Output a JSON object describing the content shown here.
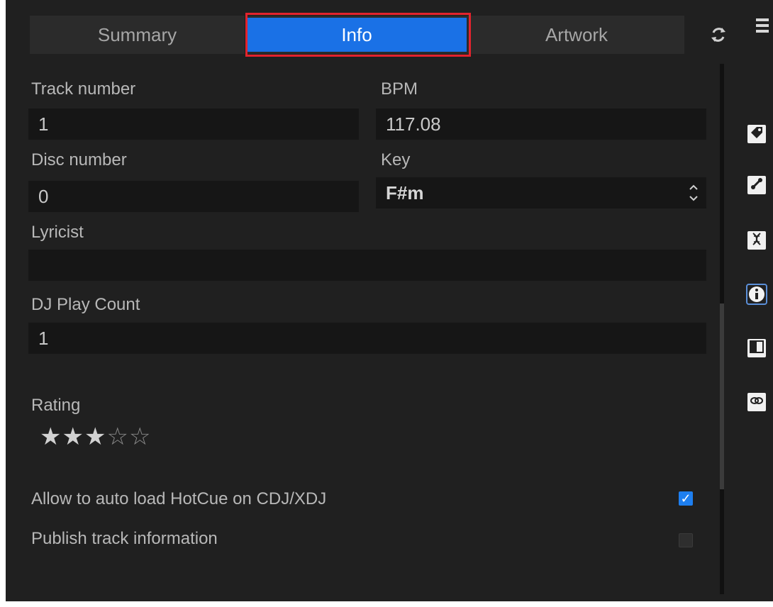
{
  "tabs": {
    "summary": "Summary",
    "info": "Info",
    "artwork": "Artwork",
    "active": "Info"
  },
  "form": {
    "track_number": {
      "label": "Track number",
      "value": "1"
    },
    "bpm": {
      "label": "BPM",
      "value": "117.08"
    },
    "disc_number": {
      "label": "Disc number",
      "value": "0"
    },
    "key": {
      "label": "Key",
      "value": "F#m"
    },
    "lyricist": {
      "label": "Lyricist",
      "value": ""
    },
    "dj_play_count": {
      "label": "DJ Play Count",
      "value": "1"
    },
    "rating": {
      "label": "Rating",
      "value": 3,
      "max": 5
    },
    "auto_load_hotcue": {
      "label": "Allow to auto load HotCue on CDJ/XDJ",
      "checked": true
    },
    "publish_track_info": {
      "label": "Publish track information",
      "checked": false
    }
  },
  "side_icons": [
    "tag-icon",
    "edit-link-icon",
    "dna-icon",
    "info-icon",
    "panel-toggle-icon",
    "link-icon"
  ],
  "colors": {
    "background": "#202020",
    "active_tab": "#1a71e6",
    "highlight_border": "#e3232d",
    "checkbox_checked": "#1e7ff0"
  }
}
